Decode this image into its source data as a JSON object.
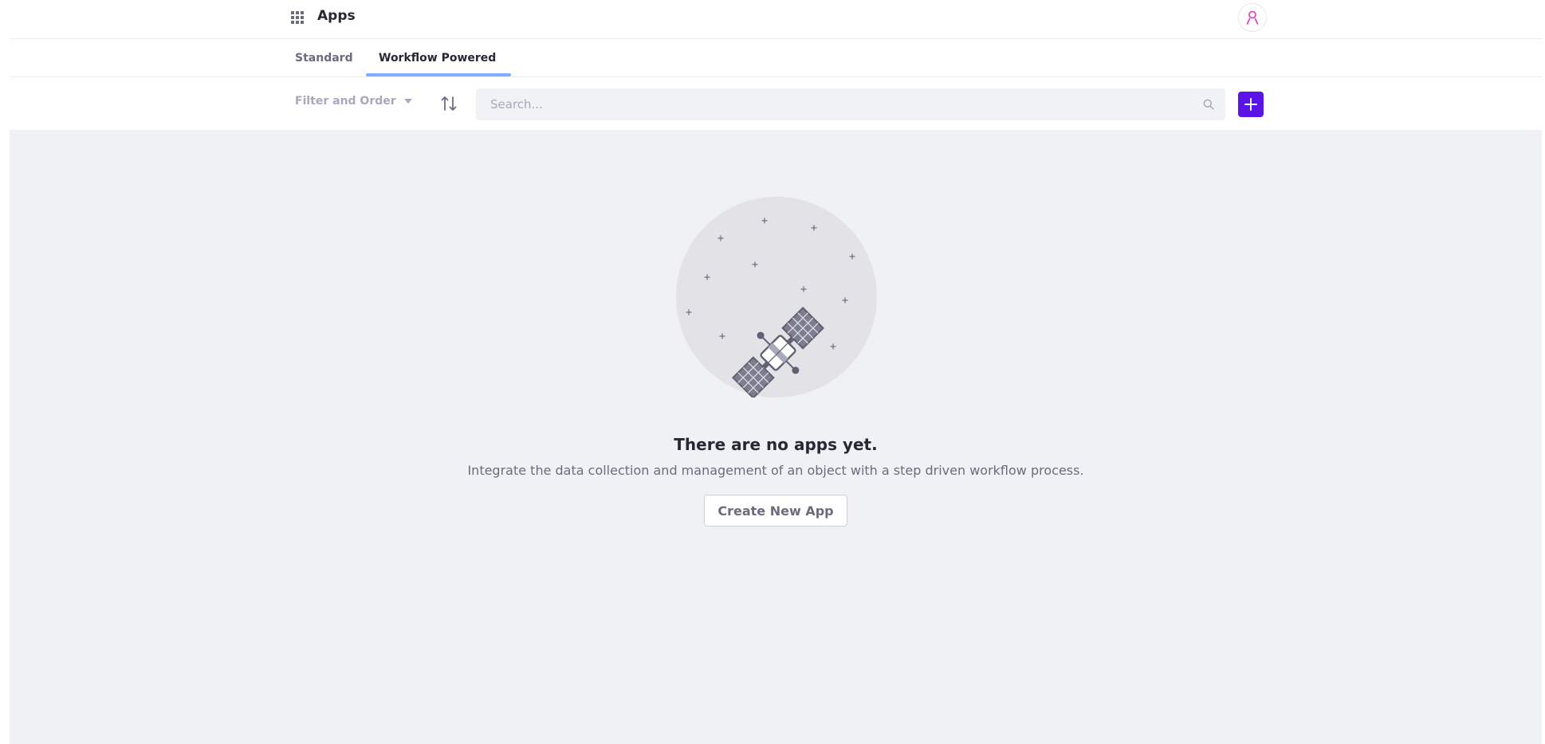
{
  "header": {
    "title": "Apps",
    "apps_icon": "grid-icon",
    "user_icon": "user-icon",
    "user_icon_color": "#e04cbb"
  },
  "tabs": [
    {
      "label": "Standard",
      "active": false
    },
    {
      "label": "Workflow Powered",
      "active": true
    }
  ],
  "toolbar": {
    "filter_label": "Filter and Order",
    "filter_icon": "caret-down-icon",
    "sort_icon": "order-arrows-icon",
    "search_placeholder": "Search...",
    "search_value": "",
    "search_icon": "search-icon",
    "add_icon": "plus-icon",
    "accent_color": "#5a14e8"
  },
  "empty_state": {
    "illustration": "satellite-icon",
    "title": "There are no apps yet.",
    "description": "Integrate the data collection and management of an object with a step driven workflow process.",
    "button_label": "Create New App"
  }
}
